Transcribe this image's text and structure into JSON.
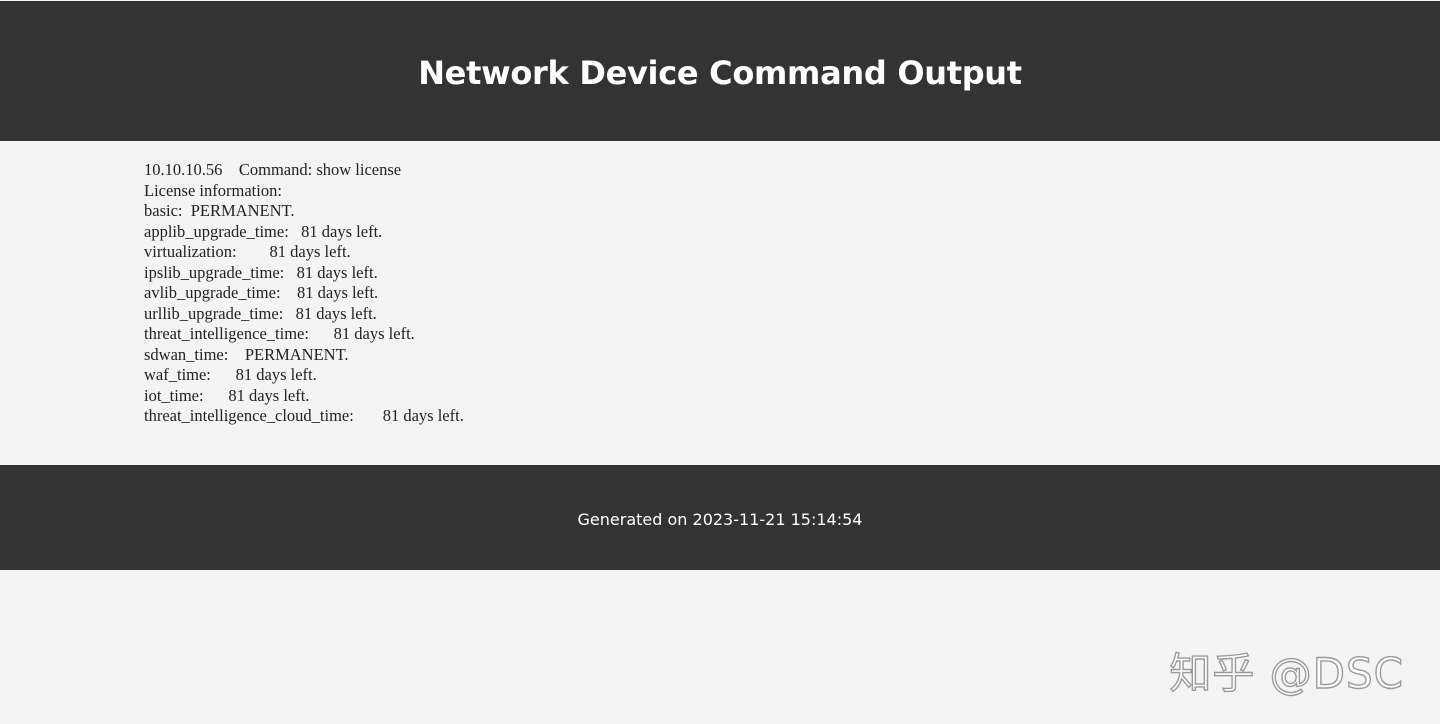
{
  "header": {
    "title": "Network Device Command Output"
  },
  "output": {
    "lines": [
      "10.10.10.56    Command: show license",
      "License information:",
      "basic:  PERMANENT.",
      "applib_upgrade_time:   81 days left.",
      "virtualization:        81 days left.",
      "ipslib_upgrade_time:   81 days left.",
      "avlib_upgrade_time:    81 days left.",
      "urllib_upgrade_time:   81 days left.",
      "threat_intelligence_time:      81 days left.",
      "sdwan_time:    PERMANENT.",
      "waf_time:      81 days left.",
      "iot_time:      81 days left.",
      "threat_intelligence_cloud_time:       81 days left."
    ]
  },
  "footer": {
    "text": "Generated on 2023-11-21 15:14:54"
  },
  "watermark": {
    "text": "知乎 @DSC"
  },
  "colors": {
    "bar_background": "#333333",
    "page_background": "#f4f4f4",
    "bar_text": "#ffffff"
  }
}
